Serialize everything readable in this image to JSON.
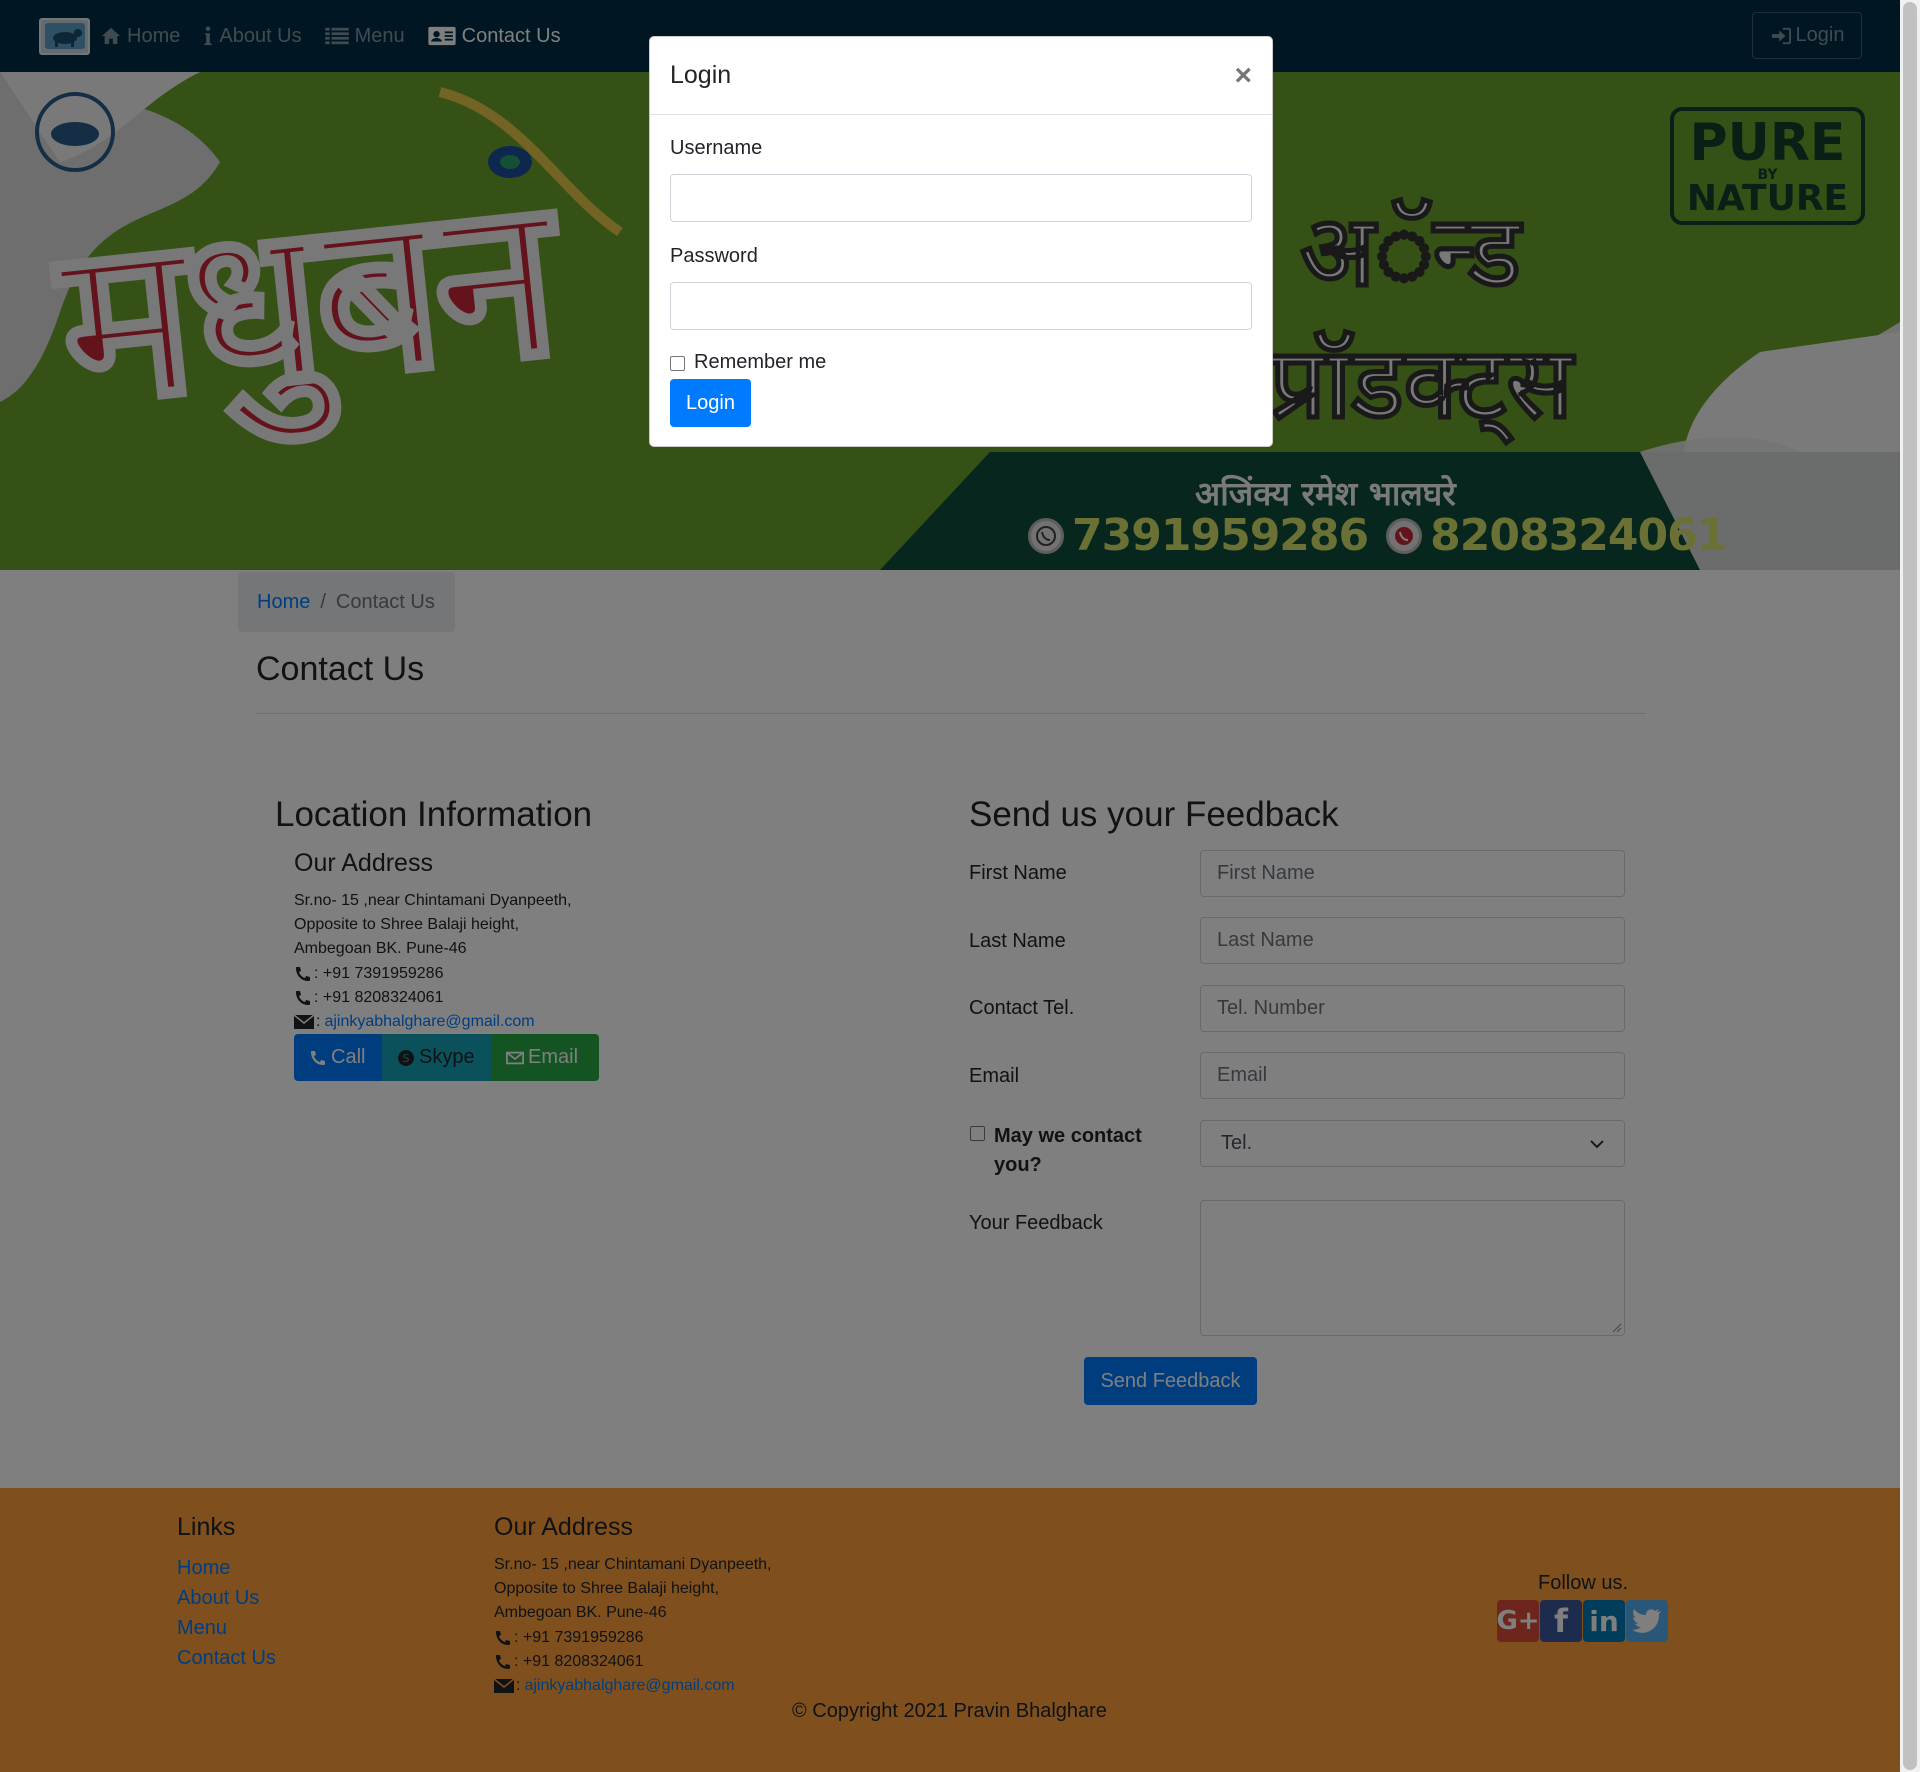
{
  "nav": {
    "items": [
      {
        "label": "Home",
        "icon": "home-icon"
      },
      {
        "label": "About Us",
        "icon": "info-icon"
      },
      {
        "label": "Menu",
        "icon": "list-icon"
      },
      {
        "label": "Contact Us",
        "icon": "address-card-icon"
      }
    ],
    "active_index": 3,
    "login_label": "Login",
    "colors": {
      "background": "#002d45",
      "item": "rgba(255,255,255,0.5)",
      "active": "#ffffff"
    }
  },
  "banner": {
    "title": "मधुबन",
    "and": "अॅन्ड",
    "products": "प्रॉडक्ट्स",
    "owner": "अजिंक्य रमेश भालघरे",
    "phone1": "7391959286",
    "phone2": "8208324061",
    "badge": {
      "line1": "PURE",
      "line2": "BY",
      "line3": "NATURE"
    },
    "colors": {
      "green": "#6aa32c",
      "dark_green": "#0f4d3a",
      "red": "#c9263a"
    }
  },
  "breadcrumb": {
    "home": "Home",
    "separator": "/",
    "current": "Contact Us"
  },
  "page_title": "Contact Us",
  "location": {
    "heading": "Location Information",
    "address_heading": "Our Address",
    "address_lines": [
      "Sr.no- 15 ,near Chintamani Dyanpeeth,",
      "Opposite to Shree Balaji height,",
      "Ambegoan BK. Pune-46"
    ],
    "phone1": ": +91 7391959286",
    "phone2": ": +91 8208324061",
    "email_prefix": ":",
    "email": "ajinkyabhalghare@gmail.com",
    "buttons": {
      "call": "Call",
      "skype": "Skype",
      "email": "Email"
    },
    "button_colors": {
      "call": "#007bff",
      "skype": "#17a2b8",
      "email": "#28a745"
    }
  },
  "feedback": {
    "heading": "Send us your Feedback",
    "fields": [
      {
        "label": "First Name",
        "placeholder": "First Name"
      },
      {
        "label": "Last Name",
        "placeholder": "Last Name"
      },
      {
        "label": "Contact Tel.",
        "placeholder": "Tel. Number"
      },
      {
        "label": "Email",
        "placeholder": "Email"
      }
    ],
    "contact_check_label": "May we contact you?",
    "contact_method": "Tel.",
    "feedback_label": "Your Feedback",
    "feedback_value": "",
    "submit_label": "Send Feedback"
  },
  "footer": {
    "links_heading": "Links",
    "links": [
      "Home",
      "About Us",
      "Menu",
      "Contact Us"
    ],
    "address_heading": "Our Address",
    "address_lines": [
      "Sr.no- 15 ,near Chintamani Dyanpeeth,",
      "Opposite to Shree Balaji height,",
      "Ambegoan BK. Pune-46"
    ],
    "phone1": ": +91 7391959286",
    "phone2": ": +91 8208324061",
    "email_prefix": ":",
    "email": "ajinkyabhalghare@gmail.com",
    "copyright": "© Copyright 2021 Pravin Bhalghare",
    "follow_label": "Follow us.",
    "social": {
      "google": "G+",
      "facebook": "f",
      "linkedin": "in",
      "twitter": "twitter-icon"
    },
    "colors": {
      "background": "#ffa13c",
      "google": "#dd4b39",
      "facebook": "#3b5998",
      "linkedin": "#007bb5",
      "twitter": "#55acee"
    }
  },
  "modal": {
    "title": "Login",
    "close": "×",
    "username_label": "Username",
    "username_value": "",
    "password_label": "Password",
    "password_value": "",
    "remember_label": "Remember me",
    "submit_label": "Login"
  }
}
